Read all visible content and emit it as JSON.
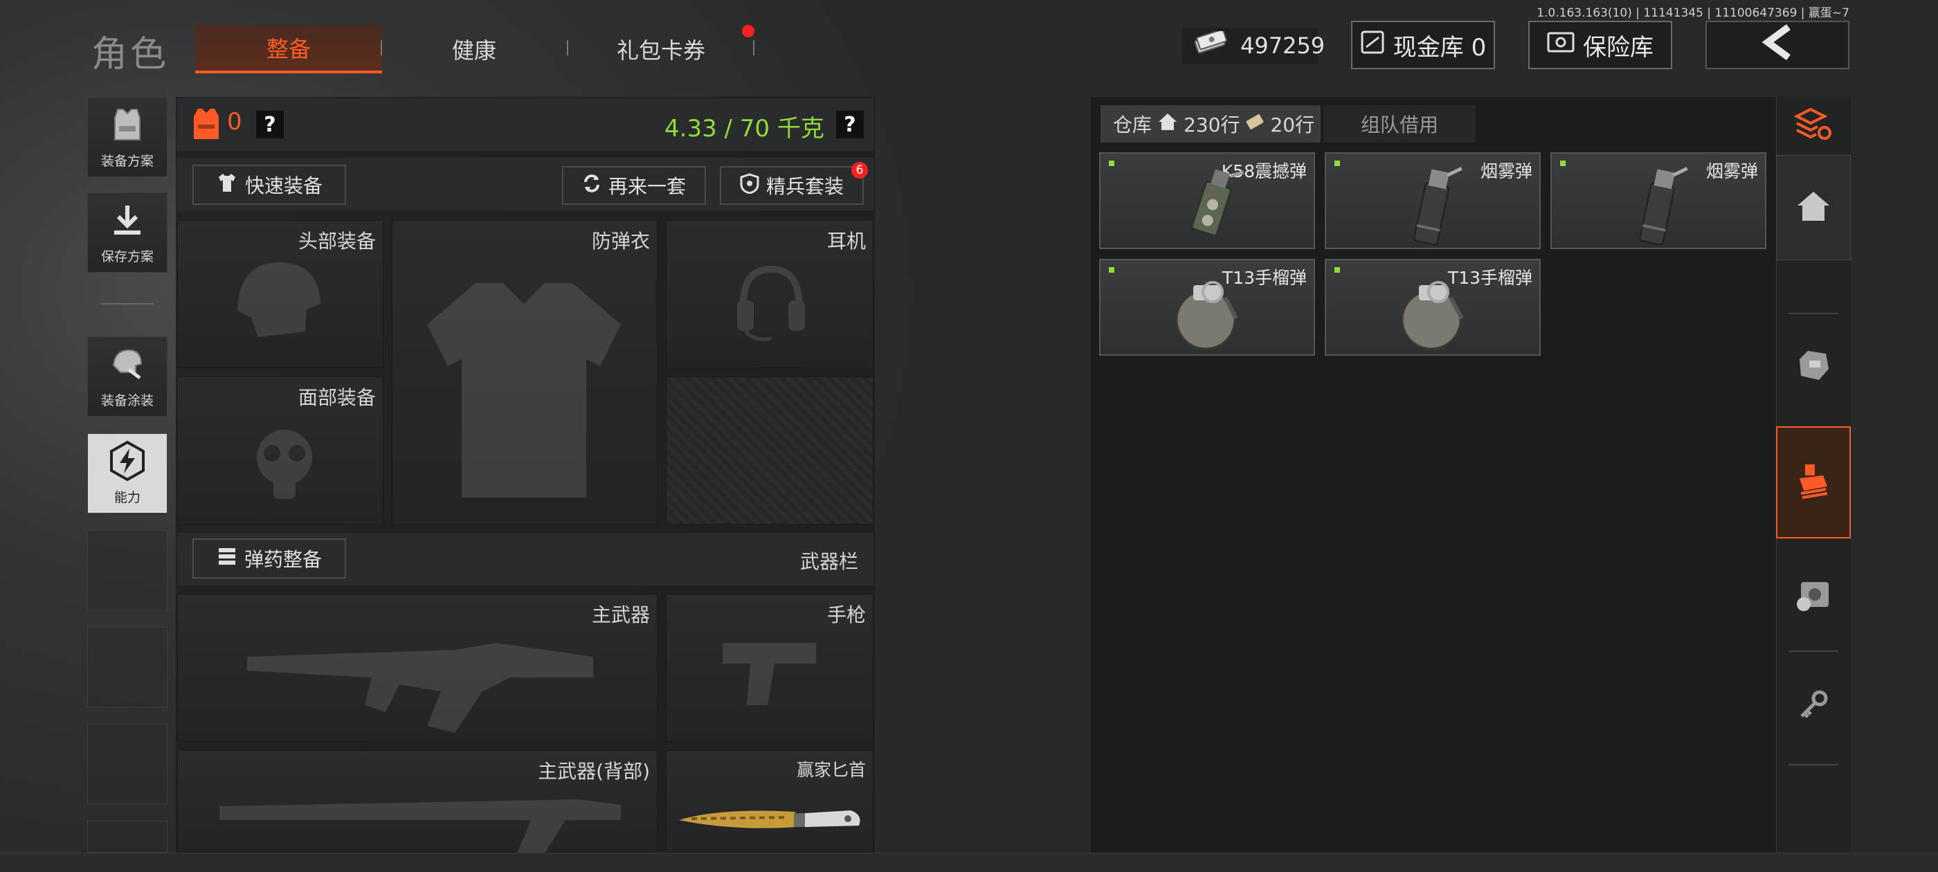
{
  "build_info": "1.0.163.163(10) | 11141345 | 11100647369 | 赢蛋~7",
  "header": {
    "title": "角色",
    "tabs": [
      {
        "label": "整备",
        "active": true
      },
      {
        "label": "健康",
        "active": false
      },
      {
        "label": "礼包卡券",
        "active": false,
        "badge_dot": true
      }
    ],
    "money": "497259",
    "cash_vault_label": "现金库 0",
    "safe_label": "保险库",
    "back_icon": "chevron-left-icon"
  },
  "sidebar": {
    "items": [
      {
        "label": "装备方案",
        "icon": "armor-vest-icon"
      },
      {
        "label": "保存方案",
        "icon": "download-icon"
      },
      {
        "label": "装备涂装",
        "icon": "helmet-paint-icon"
      },
      {
        "label": "能力",
        "icon": "ability-bolt-icon",
        "active": true
      }
    ]
  },
  "loadout": {
    "armor_count": "0",
    "help": "?",
    "weight": "4.33 / 70 千克",
    "weight_help": "?",
    "quick_equip": "快速装备",
    "reroll": "再来一套",
    "elite_kit": "精兵套装",
    "elite_badge": "6",
    "slots": {
      "head": "头部装备",
      "armor": "防弹衣",
      "earphone": "耳机",
      "face": "面部装备"
    },
    "ammo_btn": "弹药整备",
    "weapons_label": "武器栏",
    "weapon_slots": {
      "primary": "主武器",
      "pistol": "手枪",
      "primary_back": "主武器(背部)",
      "melee": "赢家匕首"
    }
  },
  "storage": {
    "tab_warehouse": "仓库",
    "rows_home": "230行",
    "rows_ticket": "20行",
    "tab_team": "组队借用",
    "items": [
      {
        "name": "K58震撼弹",
        "icon": "stun-grenade-icon"
      },
      {
        "name": "烟雾弹",
        "icon": "smoke-grenade-icon"
      },
      {
        "name": "烟雾弹",
        "icon": "smoke-grenade-icon"
      },
      {
        "name": "T13手榴弹",
        "icon": "frag-grenade-icon"
      },
      {
        "name": "T13手榴弹",
        "icon": "frag-grenade-icon"
      }
    ]
  },
  "rail": {
    "icons": [
      "stack-refresh-icon",
      "home-icon",
      "armor-icon",
      "ammo-crate-icon",
      "safe-box-icon",
      "key-icon"
    ],
    "active_index": 3
  },
  "colors": {
    "accent": "#ff5a28",
    "weight_green": "#8fdc3a",
    "badge_red": "#ff2020"
  }
}
